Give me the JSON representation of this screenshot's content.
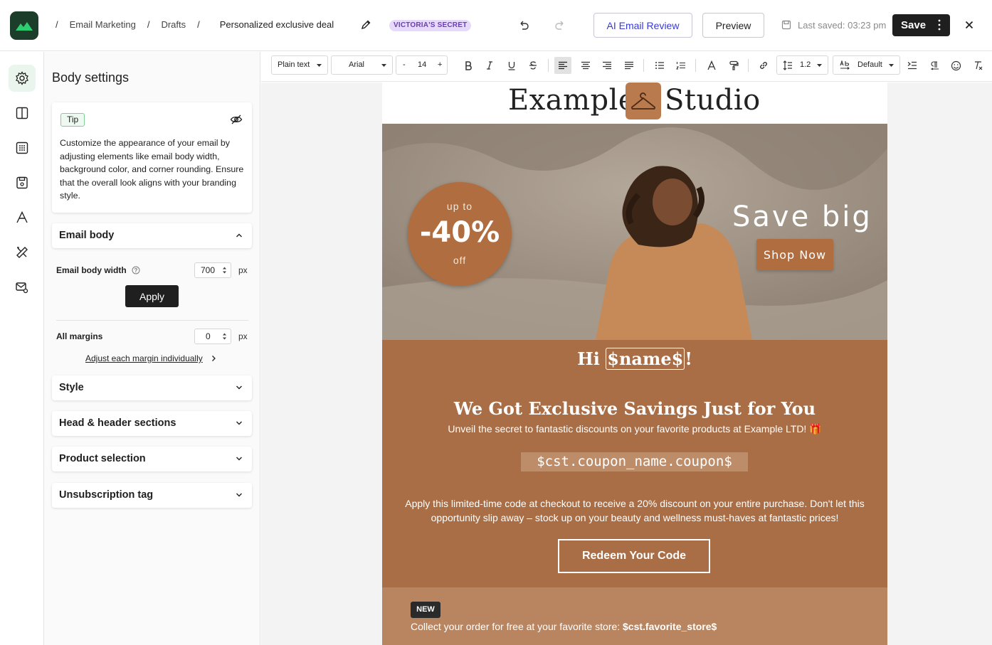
{
  "breadcrumb": {
    "items": [
      "Email Marketing",
      "Drafts"
    ],
    "current": "Personalized exclusive deal"
  },
  "brand_badge": "VICTORIA'S SECRET",
  "header": {
    "ai_review_label": "AI Email Review",
    "preview_label": "Preview",
    "last_saved": "Last saved: 03:23 pm",
    "save_label": "Save"
  },
  "rail": {
    "icons": [
      "gear-icon",
      "layout-columns-icon",
      "grid-icon",
      "save-template-icon",
      "typography-icon",
      "tools-icon",
      "mail-settings-icon"
    ],
    "active": "gear-icon"
  },
  "panel": {
    "title": "Body settings",
    "tip": {
      "badge": "Tip",
      "text": "Customize the appearance of your email by adjusting elements like email body width, background color, and corner rounding. Ensure that the overall look aligns with your branding style."
    },
    "email_body": {
      "label": "Email body",
      "width_label": "Email body width",
      "width_value": "700",
      "unit": "px",
      "apply_label": "Apply",
      "margins_label": "All margins",
      "margins_value": "0",
      "adjust_link": "Adjust each margin individually"
    },
    "sections": [
      "Style",
      "Head & header sections",
      "Product selection",
      "Unsubscription tag"
    ]
  },
  "toolbar": {
    "text_type": "Plain text",
    "font": "Arial",
    "font_size": "14",
    "minus": "-",
    "plus": "+",
    "line_height": "1.2",
    "spacing": "Default"
  },
  "email": {
    "logo_left": "Example",
    "logo_right": "Studio",
    "hero": {
      "up_to": "up to",
      "discount": "-40%",
      "off": "off",
      "headline": "Save big",
      "cta": "Shop Now"
    },
    "greeting_prefix": "Hi ",
    "greeting_token": "$name$",
    "greeting_suffix": "!",
    "headline": "We Got Exclusive Savings Just for You",
    "subline": "Unveil the secret to fantastic discounts on your favorite products at Example LTD! 🎁",
    "coupon": "$cst.coupon_name.coupon$",
    "paragraph": "Apply this limited-time code at checkout to receive a 20% discount on your entire purchase. Don't let this opportunity slip away – stock up on your beauty and wellness must-haves at fantastic prices!",
    "redeem_label": "Redeem Your Code",
    "new_badge": "NEW",
    "collect_text": "Collect your order for free at your favorite store: ",
    "collect_token": "$cst.favorite_store$"
  },
  "colors": {
    "accent_brown": "#a96e45",
    "circle_brown": "#b06d3f",
    "tan": "#b88560",
    "brand_green": "#1d3d2b",
    "ai_blue": "#3a3ad0"
  }
}
